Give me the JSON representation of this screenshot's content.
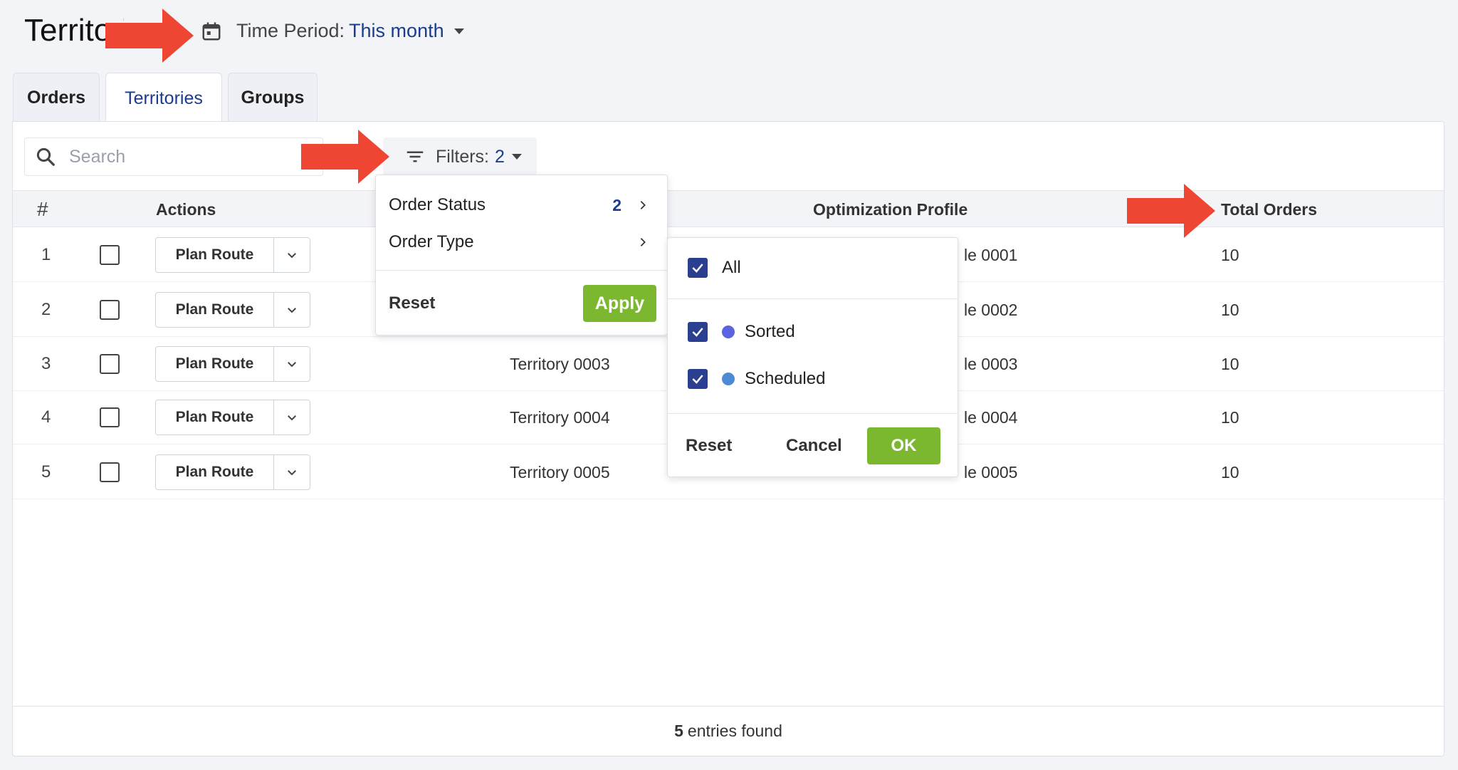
{
  "header": {
    "title": "Territories",
    "time_period_label": "Time Period:",
    "time_period_value": "This month"
  },
  "tabs": [
    {
      "label": "Orders",
      "active": false
    },
    {
      "label": "Territories",
      "active": true
    },
    {
      "label": "Groups",
      "active": false
    }
  ],
  "toolbar": {
    "search_placeholder": "Search",
    "filters_label": "Filters:",
    "filters_count": "2"
  },
  "table": {
    "columns": {
      "hash": "#",
      "actions": "Actions",
      "optimization_profile": "Optimization Profile",
      "total_orders": "Total Orders"
    },
    "plan_route_label": "Plan Route",
    "rows": [
      {
        "num": "1",
        "territory": "",
        "profile": "le 0001",
        "total": "10"
      },
      {
        "num": "2",
        "territory": "",
        "profile": "le 0002",
        "total": "10"
      },
      {
        "num": "3",
        "territory": "Territory 0003",
        "profile": "le 0003",
        "total": "10"
      },
      {
        "num": "4",
        "territory": "Territory 0004",
        "profile": "le 0004",
        "total": "10"
      },
      {
        "num": "5",
        "territory": "Territory 0005",
        "profile": "le 0005",
        "total": "10"
      }
    ]
  },
  "footer": {
    "count": "5",
    "text": "entries found"
  },
  "filter_menu": {
    "items": [
      {
        "label": "Order Status",
        "badge": "2"
      },
      {
        "label": "Order Type",
        "badge": ""
      }
    ],
    "reset_label": "Reset",
    "apply_label": "Apply"
  },
  "status_menu": {
    "all_label": "All",
    "options": [
      {
        "label": "Sorted",
        "color": "#5b63e0",
        "checked": true
      },
      {
        "label": "Scheduled",
        "color": "#4f8ad6",
        "checked": true
      }
    ],
    "reset_label": "Reset",
    "cancel_label": "Cancel",
    "ok_label": "OK"
  },
  "colors": {
    "accent": "#1a3d8f",
    "green": "#7cb82f",
    "arrow": "#ef4634"
  }
}
